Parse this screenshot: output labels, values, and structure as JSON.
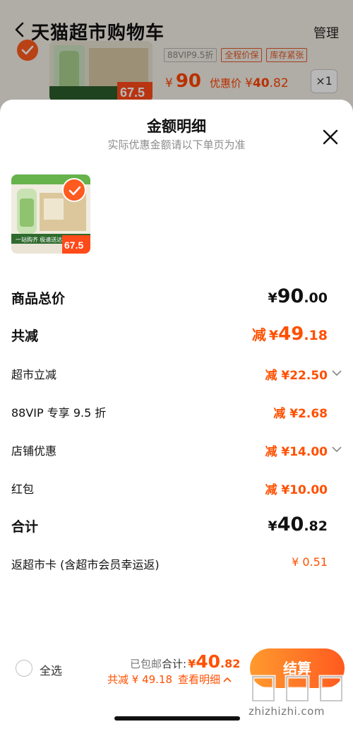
{
  "background": {
    "title": "天猫超市购物车",
    "manage_label": "管理",
    "tags": [
      "88VIP9.5折",
      "全程价保",
      "库存紧张"
    ],
    "price_currency": "¥",
    "price": "90",
    "promo_label": "优惠价",
    "promo_currency": "¥",
    "promo_int": "40",
    "promo_dec": ".82",
    "quantity": "×1"
  },
  "sheet": {
    "title": "金额明细",
    "subtitle": "实际优惠金额请以下单页为准",
    "product_image": {
      "thumb_price": "67.5",
      "banner": "一站购齐 极速送达"
    },
    "rows": [
      {
        "label": "商品总价",
        "currency": "¥",
        "int": "90",
        "dec": ".00"
      },
      {
        "label": "共减",
        "prefix": "减",
        "currency": "¥",
        "int": "49",
        "dec": ".18"
      },
      {
        "label": "超市立减",
        "value": "减 ¥22.50"
      },
      {
        "label": "88VIP 专享 9.5 折",
        "value": "减 ¥2.68"
      },
      {
        "label": "店铺优惠",
        "value": "减 ¥14.00"
      },
      {
        "label": "红包",
        "value": "减 ¥10.00"
      },
      {
        "label": "合计",
        "currency": "¥",
        "int": "40",
        "dec": ".82"
      },
      {
        "label": "返超市卡 (含超市会员幸运返)",
        "value": "¥ 0.51"
      }
    ]
  },
  "bottom": {
    "select_all": "全选",
    "shipped": "已包邮",
    "total_label": "合计:",
    "currency": "¥",
    "total_int": "40",
    "total_dec": ".82",
    "discount_text": "共减 ¥ 49.18",
    "view_detail": "查看明细",
    "checkout": "结算"
  },
  "watermark": {
    "url": "zhizhizhi.com"
  },
  "colors": {
    "accent": "#ff5000",
    "button_start": "#ff9a2e",
    "button_end": "#ff5a1f"
  }
}
